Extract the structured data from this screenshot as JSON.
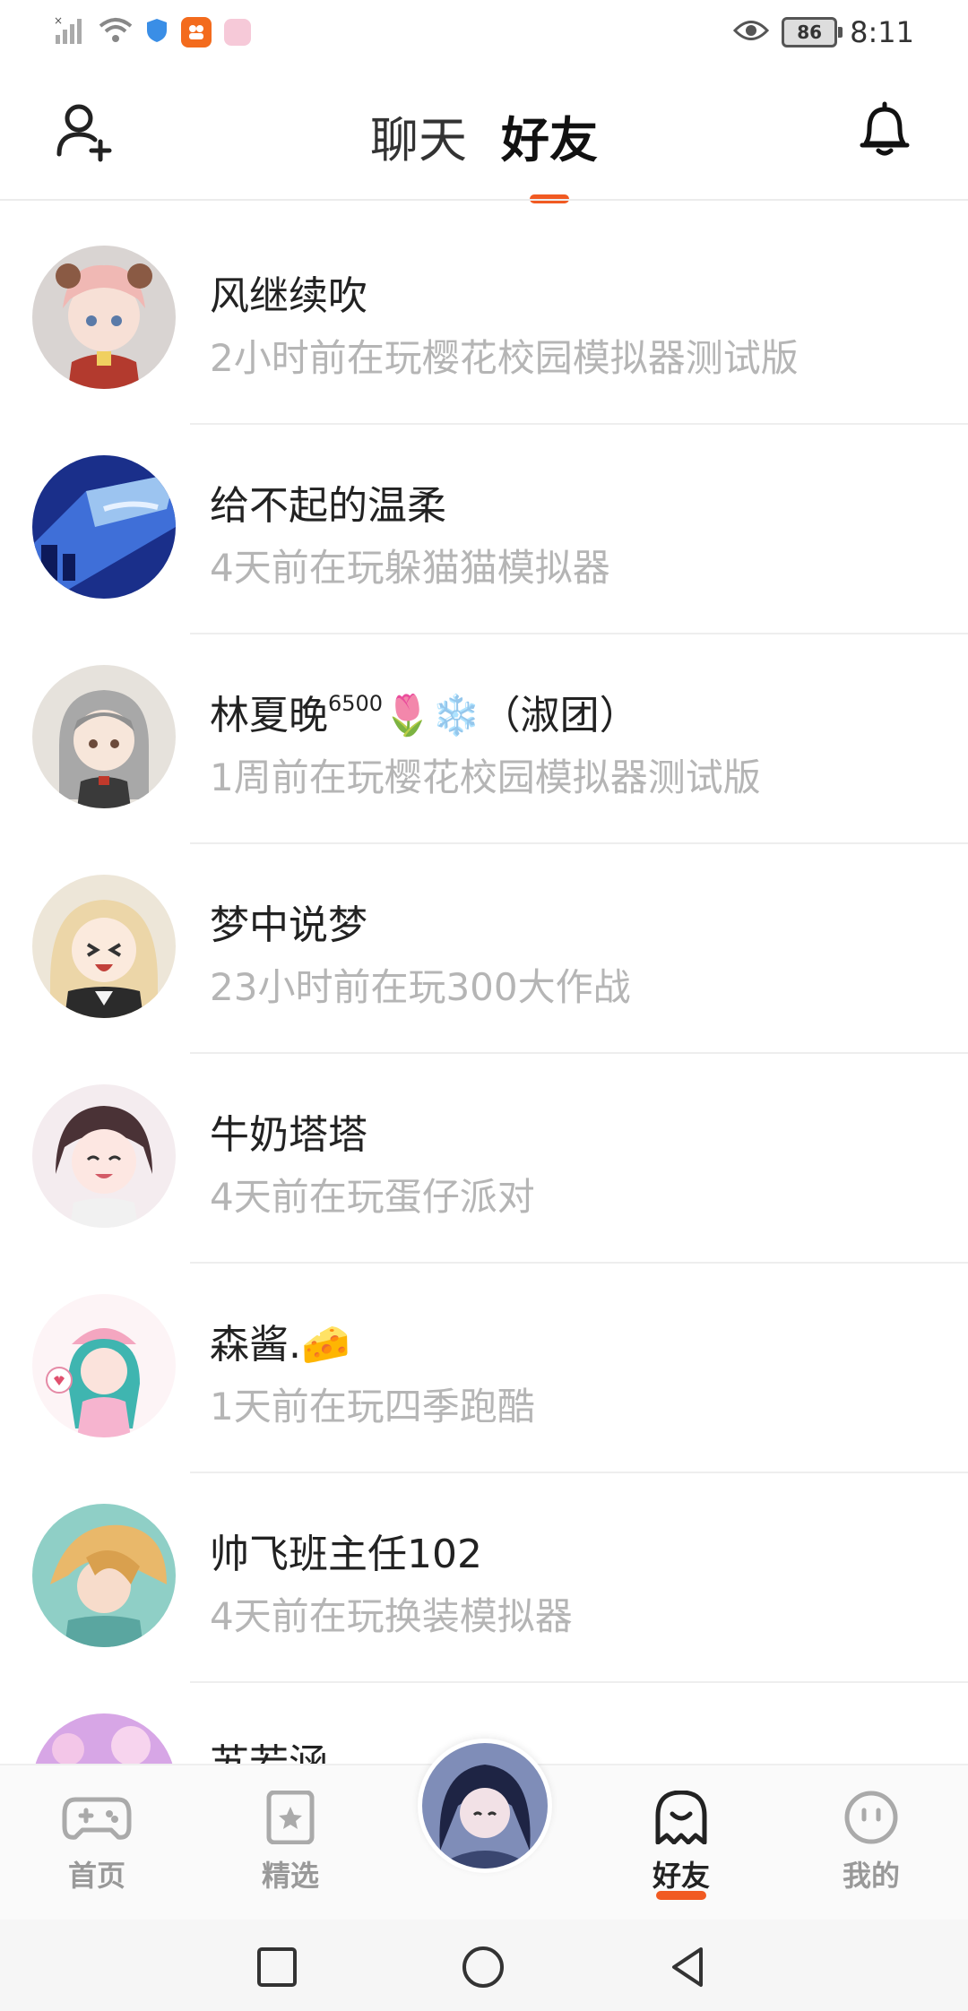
{
  "status_bar": {
    "time": "8:11",
    "battery": "86",
    "icons": [
      "signal-icon",
      "wifi-icon",
      "shield-icon",
      "app-icon",
      "app-icon",
      "eye-icon"
    ]
  },
  "header": {
    "tabs": [
      {
        "label": "聊天",
        "active": false
      },
      {
        "label": "好友",
        "active": true
      }
    ]
  },
  "friends": [
    {
      "name": "风继续吹",
      "status": "2小时前在玩樱花校园模拟器测试版"
    },
    {
      "name": "给不起的温柔",
      "status": "4天前在玩躲猫猫模拟器"
    },
    {
      "name": "林夏晚",
      "name_sup": "6500",
      "name_suffix": "🌷❄️（淑团）",
      "status": "1周前在玩樱花校园模拟器测试版"
    },
    {
      "name": "梦中说梦",
      "status": "23小时前在玩300大作战"
    },
    {
      "name": "牛奶塔塔",
      "status": "4天前在玩蛋仔派对"
    },
    {
      "name": "森酱.🧀",
      "status": "1天前在玩四季跑酷"
    },
    {
      "name": "帅飞班主任102",
      "status": "4天前在玩换装模拟器"
    },
    {
      "name": "苏若涵",
      "status": ""
    }
  ],
  "bottom_nav": {
    "items": [
      {
        "label": "首页",
        "icon": "gamepad-icon"
      },
      {
        "label": "精选",
        "icon": "bookmark-star-icon"
      },
      {
        "label": "好友",
        "icon": "ghost-icon",
        "active": true
      },
      {
        "label": "我的",
        "icon": "smiley-icon"
      }
    ]
  },
  "colors": {
    "accent": "#f15a22",
    "secondary_text": "#b5b5b5"
  }
}
